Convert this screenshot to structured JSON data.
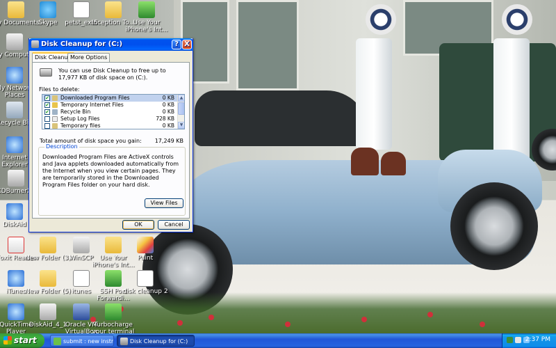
{
  "desktop_icons": {
    "my_documents": "My Documents",
    "skype": "Skype",
    "petst": "petst_ext5",
    "inception": "Inception To...",
    "use_iphone_top": "Use Your iPhone's Int...",
    "my_computer": "My Computer",
    "my_network": "My Network Places",
    "recycle_bin": "Recycle Bin",
    "ie": "Internet Explorer",
    "cdburner": "CDBurnerXP",
    "diskaid": "DiskAid",
    "foxit": "Foxit Reader",
    "new_folder_3": "New Folder (3)",
    "winscp": "WinSCP",
    "use_iphone_mid": "Use Your iPhone's Int...",
    "paint": "Paint",
    "itunes": "iTunes",
    "new_folder_5": "New Folder (5)",
    "itunes2": "itunes",
    "ssh_port": "SSH Port Forwardi...",
    "disk_cleanup_2": "disk cleanup 2",
    "quicktime": "QuickTime Player",
    "diskaid_4": "DiskAid_4_1",
    "oracle_vm": "Oracle VM VirtualBox",
    "turbocharge": "Turbocharge your terminal"
  },
  "dialog": {
    "title": "Disk Cleanup for  (C:)",
    "help_symbol": "?",
    "close_symbol": "X",
    "tabs": [
      "Disk Cleanup",
      "More Options"
    ],
    "intro": "You can use Disk Cleanup to free up to 17,977 KB of disk space on  (C:).",
    "files_label": "Files to delete:",
    "files": [
      {
        "name": "Downloaded Program Files",
        "size": "0 KB",
        "checked": true
      },
      {
        "name": "Temporary Internet Files",
        "size": "0 KB",
        "checked": true
      },
      {
        "name": "Recycle Bin",
        "size": "0 KB",
        "checked": true
      },
      {
        "name": "Setup Log Files",
        "size": "728 KB",
        "checked": false
      },
      {
        "name": "Temporary files",
        "size": "0 KB",
        "checked": false
      }
    ],
    "check_mark": "✔",
    "total_label": "Total amount of disk space you gain:",
    "total_value": "17,249 KB",
    "description_legend": "Description",
    "description": "Downloaded Program Files are ActiveX controls and Java applets downloaded automatically from the Internet when you view certain pages. They are temporarily stored in the Downloaded Program Files folder on your hard disk.",
    "view_files": "View Files",
    "ok": "OK",
    "cancel": "Cancel"
  },
  "taskbar": {
    "start": "start",
    "tasks": [
      "submit : new instruct...",
      "Disk Cleanup for  (C:)"
    ],
    "clock": "2:37 PM"
  },
  "scroll_arrows": {
    "up": "▲",
    "down": "▼"
  }
}
